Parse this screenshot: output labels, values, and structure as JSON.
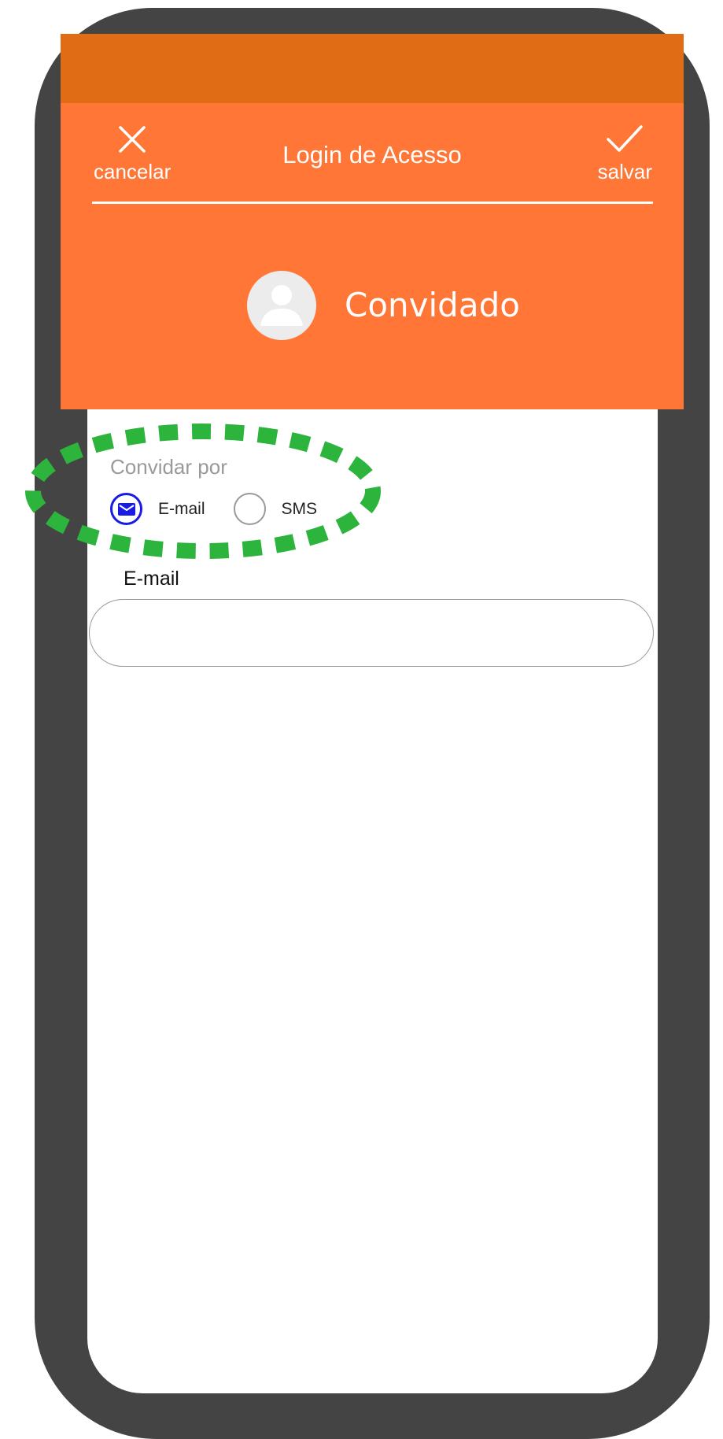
{
  "header": {
    "cancel_label": "cancelar",
    "title": "Login de Acesso",
    "save_label": "salvar"
  },
  "profile": {
    "name": "Convidado"
  },
  "invite": {
    "label": "Convidar por",
    "options": [
      {
        "label": "E-mail",
        "selected": true,
        "icon": "envelope-icon"
      },
      {
        "label": "SMS",
        "selected": false
      }
    ]
  },
  "email_field": {
    "label": "E-mail",
    "value": ""
  },
  "colors": {
    "status_bar": "#E06C16",
    "header": "#FF7636",
    "selection": "#1A1AE6",
    "highlight": "#2DB43C",
    "frame": "#444444"
  }
}
